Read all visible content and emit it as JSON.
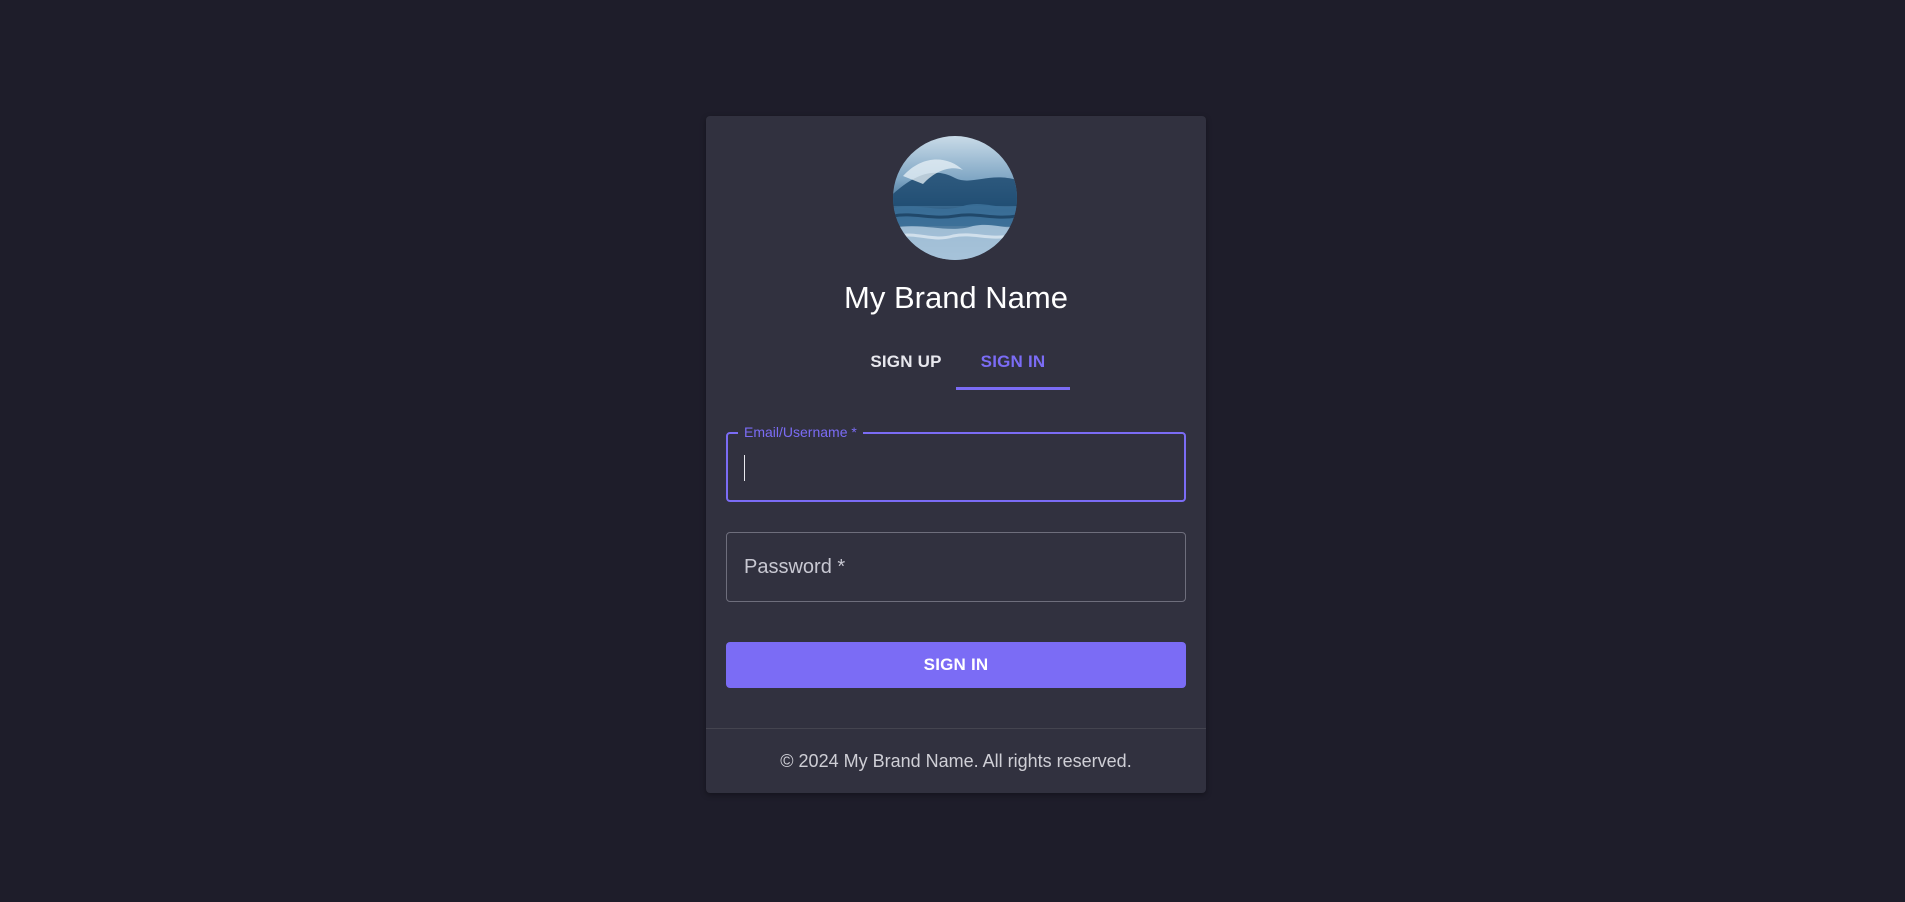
{
  "brand": {
    "name": "My Brand Name",
    "avatar_icon": "ocean-wave-image"
  },
  "tabs": [
    {
      "label": "SIGN UP",
      "active": false
    },
    {
      "label": "SIGN IN",
      "active": true
    }
  ],
  "form": {
    "email": {
      "label": "Email/Username *",
      "value": ""
    },
    "password": {
      "label": "Password *",
      "value": ""
    },
    "submit_label": "SIGN IN"
  },
  "footer": {
    "text": "© 2024 My Brand Name. All rights reserved."
  },
  "colors": {
    "background": "#1e1d2a",
    "card": "#31313f",
    "accent": "#7b6cf5"
  }
}
